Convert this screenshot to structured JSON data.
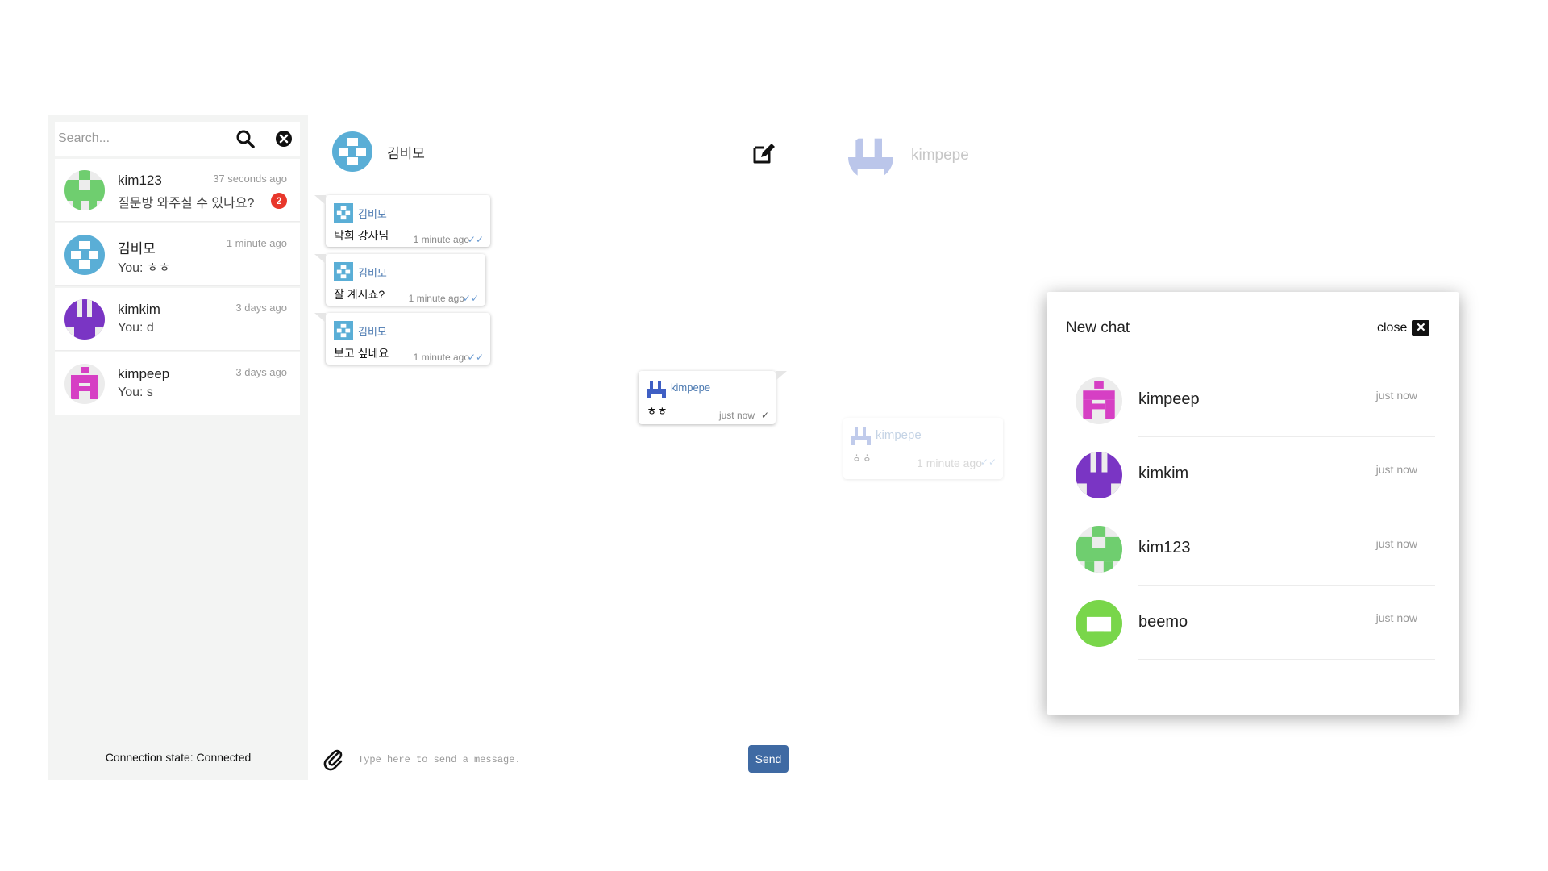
{
  "colors": {
    "accent": "#3f6aa3",
    "badge": "#e8372b",
    "avatar_green": "#6fce6f",
    "avatar_blue": "#5aaed6",
    "avatar_purple": "#7a35c4",
    "avatar_pink": "#d63fc4",
    "avatar_lime": "#79d64a"
  },
  "sidebar": {
    "search": {
      "placeholder": "Search...",
      "value": ""
    },
    "conversations": [
      {
        "name": "kim123",
        "time": "37 seconds ago",
        "preview": "질문방 와주실 수 있나요?",
        "unread": "2",
        "avatar": "green"
      },
      {
        "name": "김비모",
        "time": "1 minute ago",
        "preview": "You: ㅎㅎ",
        "avatar": "blue"
      },
      {
        "name": "kimkim",
        "time": "3 days ago",
        "preview": "You: d",
        "avatar": "purple"
      },
      {
        "name": "kimpeep",
        "time": "3 days ago",
        "preview": "You: s",
        "avatar": "pink"
      }
    ],
    "connection_state": "Connection state: Connected"
  },
  "chat": {
    "title": "김비모",
    "messages": [
      {
        "sender": "김비모",
        "text": "탁희 강사님",
        "time": "1 minute ago",
        "status_icon": "double-check-icon"
      },
      {
        "sender": "김비모",
        "text": "잘 계시죠?",
        "time": "1 minute ago",
        "status_icon": "double-check-icon"
      },
      {
        "sender": "김비모",
        "text": "보고 싶네요",
        "time": "1 minute ago",
        "status_icon": "double-check-icon"
      },
      {
        "sender": "kimpepe",
        "text": "ㅎㅎ",
        "time": "just now",
        "status_icon": "check-icon"
      }
    ],
    "input": {
      "placeholder": "Type here to send a message.",
      "value": ""
    },
    "send_label": "Send"
  },
  "ghost": {
    "header_name": "kimpepe",
    "message": {
      "sender": "kimpepe",
      "text": "ㅎㅎ",
      "time": "1 minute ago"
    }
  },
  "new_chat_modal": {
    "title": "New chat",
    "close_label": "close",
    "contacts": [
      {
        "name": "kimpeep",
        "time": "just now",
        "avatar": "pink"
      },
      {
        "name": "kimkim",
        "time": "just now",
        "avatar": "purple"
      },
      {
        "name": "kim123",
        "time": "just now",
        "avatar": "green"
      },
      {
        "name": "beemo",
        "time": "just now",
        "avatar": "lime"
      }
    ]
  }
}
